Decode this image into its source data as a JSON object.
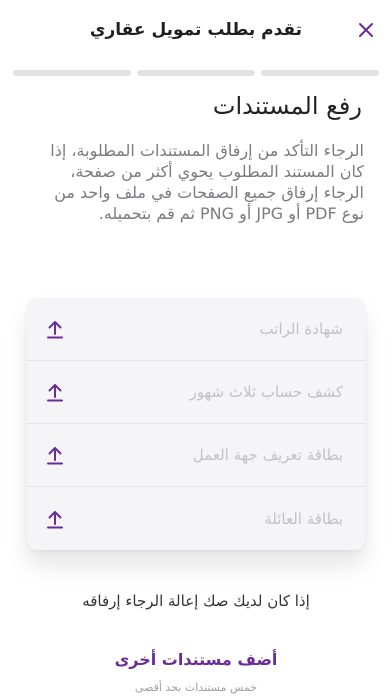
{
  "header": {
    "title": "تقدم بطلب تمويل عقاري",
    "close_icon": "close-icon"
  },
  "progress": {
    "total_steps": 3
  },
  "page": {
    "title": "رفع المستندات",
    "instructions": "الرجاء التأكد من إرفاق المستندات المطلوبة، إذا كان المستند المطلوب يحوي أكثر من صفحة، الرجاء إرفاق جميع الصفحات في ملف واحد من نوع PDF أو JPG أو PNG ثم قم بتحميله."
  },
  "documents": [
    {
      "label": "شهادة الراتب",
      "icon": "upload-icon"
    },
    {
      "label": "كشف حساب ثلاث شهور",
      "icon": "upload-icon"
    },
    {
      "label": "بطاقة تعريف جهة العمل",
      "icon": "upload-icon"
    },
    {
      "label": "بطاقة العائلة",
      "icon": "upload-icon"
    }
  ],
  "notice": "إذا كان لديك صك إعالة الرجاء إرفاقه",
  "add_more": {
    "label": "أضف مستندات أخرى",
    "sub": "خمس مستندات بحد أقصى"
  },
  "colors": {
    "accent": "#6a2c96",
    "progress_track": "#e2e2e5",
    "placeholder_text": "#c2c2c6",
    "card_bg": "#f5f5f7"
  }
}
